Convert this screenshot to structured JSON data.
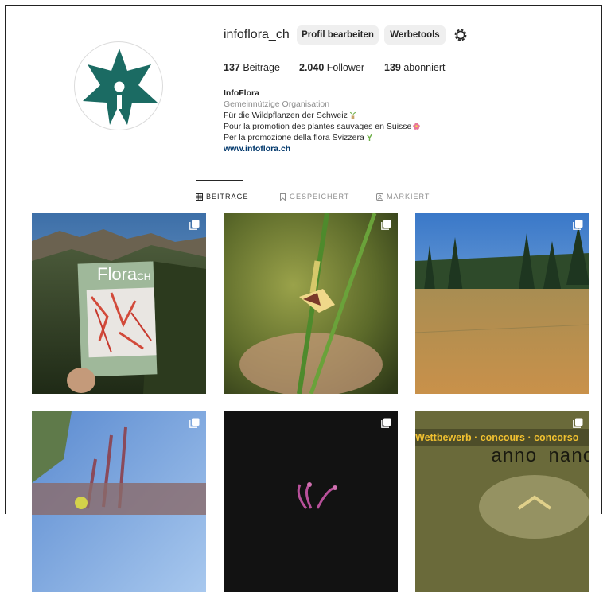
{
  "profile": {
    "username": "infoflora_ch",
    "edit_label": "Profil bearbeiten",
    "tools_label": "Werbetools",
    "stats": {
      "posts_count": "137",
      "posts_label": "Beiträge",
      "followers_count": "2.040",
      "followers_label": "Follower",
      "following_count": "139",
      "following_label": "abonniert"
    },
    "bio": {
      "name": "InfoFlora",
      "category": "Gemeinnützige Organisation",
      "line1": "Für die Wildpflanzen der Schweiz",
      "line2": "Pour la promotion des plantes sauvages en Suisse",
      "line3": "Per la promozione della flora Svizzera",
      "website": "www.infoflora.ch"
    }
  },
  "tabs": [
    {
      "label": "BEITRÄGE",
      "active": true
    },
    {
      "label": "GESPEICHERT",
      "active": false
    },
    {
      "label": "MARKIERT",
      "active": false
    }
  ],
  "posts": {
    "p1_magazine_title": "Flora",
    "p1_magazine_sub": "CH",
    "p6_banner": "Wettbewerb · concours · concorso",
    "p6_title": "anno nano"
  },
  "colors": {
    "logo": "#1b6b63",
    "link": "#00376b",
    "button_bg": "#efefef"
  }
}
